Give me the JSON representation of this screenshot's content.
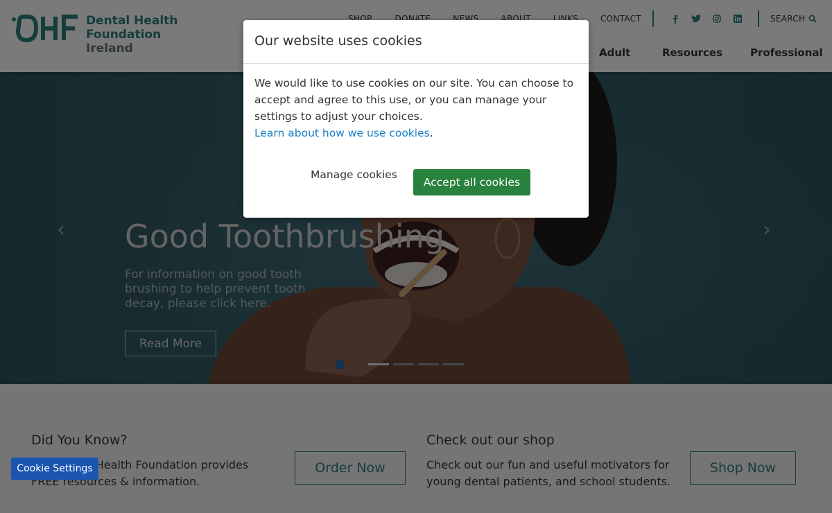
{
  "logo": {
    "mark": "DHF",
    "line1": "Dental Health",
    "line2": "Foundation",
    "line3": "Ireland"
  },
  "topnav": [
    "SHOP",
    "DONATE",
    "NEWS",
    "ABOUT",
    "LINKS",
    "CONTACT"
  ],
  "socials": [
    "facebook-icon",
    "twitter-icon",
    "instagram-icon",
    "linkedin-icon"
  ],
  "search_label": "SEARCH",
  "mainnav": [
    "Adult",
    "Resources",
    "Professional"
  ],
  "hero": {
    "title": "Good Toothbrushing",
    "subtitle": "For information on good tooth brushing to help prevent tooth decay, please click here.",
    "button": "Read More",
    "prev": "‹",
    "next": "›"
  },
  "lower": {
    "left_heading": "Did You Know?",
    "left_text": "The Dental Health Foundation provides FREE resources & information.",
    "left_button": "Order Now",
    "right_heading": "Check out our shop",
    "right_text": "Check out our fun and useful motivators for young dental patients, and school students.",
    "right_button": "Shop Now"
  },
  "modal": {
    "title": "Our website uses cookies",
    "body": "We would like to use cookies on our site. You can choose to accept and agree to this use, or you can manage your settings to adjust your choices.",
    "link": "Learn about how we use cookies",
    "link_suffix": ".",
    "manage": "Manage cookies",
    "accept": "Accept all cookies"
  },
  "cookie_settings": "Cookie Settings",
  "colors": {
    "brand": "#2b7a78",
    "accept": "#28813c",
    "cookie_settings": "#1b55b0",
    "link": "#1a7fc4"
  }
}
